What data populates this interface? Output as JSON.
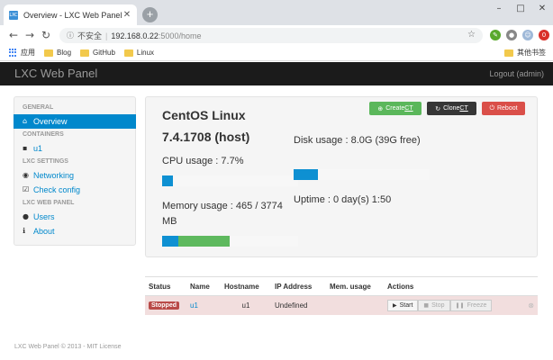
{
  "browser": {
    "tab_title": "Overview - LXC Web Panel",
    "tab_favicon": "lxc-logo",
    "new_tab": "+",
    "insecure_label": "不安全",
    "url_host": "192.168.0.22",
    "url_rest": ":5000/home",
    "bookmarks": [
      {
        "label": "应用",
        "icon": "apps-grid-icon"
      },
      {
        "label": "Blog",
        "icon": "folder-icon"
      },
      {
        "label": "GitHub",
        "icon": "folder-icon"
      },
      {
        "label": "Linux",
        "icon": "folder-icon"
      }
    ],
    "other_bookmarks": "其他书签"
  },
  "navbar": {
    "brand": "LXC Web Panel",
    "logout": "Logout (admin)"
  },
  "sidebar": {
    "sections": [
      {
        "header": "General",
        "items": [
          {
            "label": "Overview",
            "icon": "home-icon",
            "active": true
          }
        ]
      },
      {
        "header": "Containers",
        "items": [
          {
            "label": "u1",
            "icon": "container-icon",
            "active": false
          }
        ]
      },
      {
        "header": "LXC Settings",
        "items": [
          {
            "label": "Networking",
            "icon": "globe-icon",
            "active": false
          },
          {
            "label": "Check config",
            "icon": "check-icon",
            "active": false
          }
        ]
      },
      {
        "header": "LXC Web Panel",
        "items": [
          {
            "label": "Users",
            "icon": "user-icon",
            "active": false
          },
          {
            "label": "About",
            "icon": "info-icon",
            "active": false
          }
        ]
      }
    ]
  },
  "overview": {
    "buttons": {
      "create_prefix": "Create ",
      "create_ct": "CT",
      "clone_prefix": "Clone ",
      "clone_ct": "CT",
      "reboot": "Reboot"
    },
    "os_name": "CentOS Linux",
    "os_version": "7.4.1708 (host)",
    "cpu_label": "CPU usage : 7.7%",
    "cpu_percent": 7.7,
    "memory_label": "Memory usage : 465 / 3774 MB",
    "memory": {
      "used_mb": 465,
      "total_mb": 3774,
      "bar_blue_fraction": 0.12,
      "bar_green_fraction": 0.38
    },
    "disk_label": "Disk usage : 8.0G (39G free)",
    "disk": {
      "used_gb": 8.0,
      "free_gb": 39,
      "bar_fraction": 0.18
    },
    "uptime_label": "Uptime : 0 day(s) 1:50"
  },
  "containers_table": {
    "headers": [
      "Status",
      "Name",
      "Hostname",
      "IP Address",
      "Mem. usage",
      "Actions"
    ],
    "rows": [
      {
        "status": "Stopped",
        "name": "u1",
        "hostname": "u1",
        "ip": "Undefined",
        "mem": "",
        "actions": [
          "Start",
          "Stop",
          "Freeze"
        ]
      }
    ]
  },
  "footer": "LXC Web Panel © 2013 - MIT License",
  "colors": {
    "primary": "#0088cc",
    "success": "#5bb75b",
    "danger": "#da4f49",
    "inverse": "#363636",
    "navbar": "#1b1b1b",
    "stopped_row": "#f2dede"
  }
}
